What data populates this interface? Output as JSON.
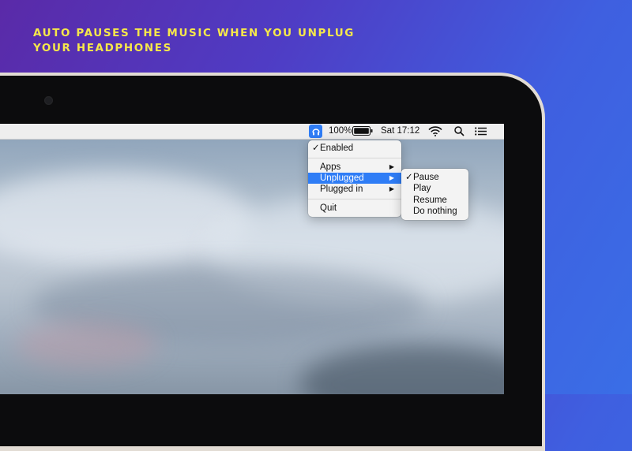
{
  "headline": [
    "AUTO PAUSES THE MUSIC WHEN YOU UNPLUG",
    "YOUR HEADPHONES"
  ],
  "menubar": {
    "app_icon": "headphones-app-icon",
    "battery_percent": "100%",
    "clock": "Sat 17:12",
    "icons": [
      "battery-icon",
      "wifi-icon",
      "search-icon",
      "notification-list-icon"
    ]
  },
  "menu": {
    "enabled": {
      "label": "Enabled",
      "checked": true
    },
    "apps": "Apps",
    "unplugged": "Unplugged",
    "plugged_in": "Plugged in",
    "quit": "Quit"
  },
  "submenu": {
    "items": [
      {
        "label": "Pause",
        "checked": true
      },
      {
        "label": "Play",
        "checked": false
      },
      {
        "label": "Resume",
        "checked": false
      },
      {
        "label": "Do nothing",
        "checked": false
      }
    ]
  },
  "colors": {
    "headline": "#f6e84a",
    "highlight": "#2f7df6"
  }
}
